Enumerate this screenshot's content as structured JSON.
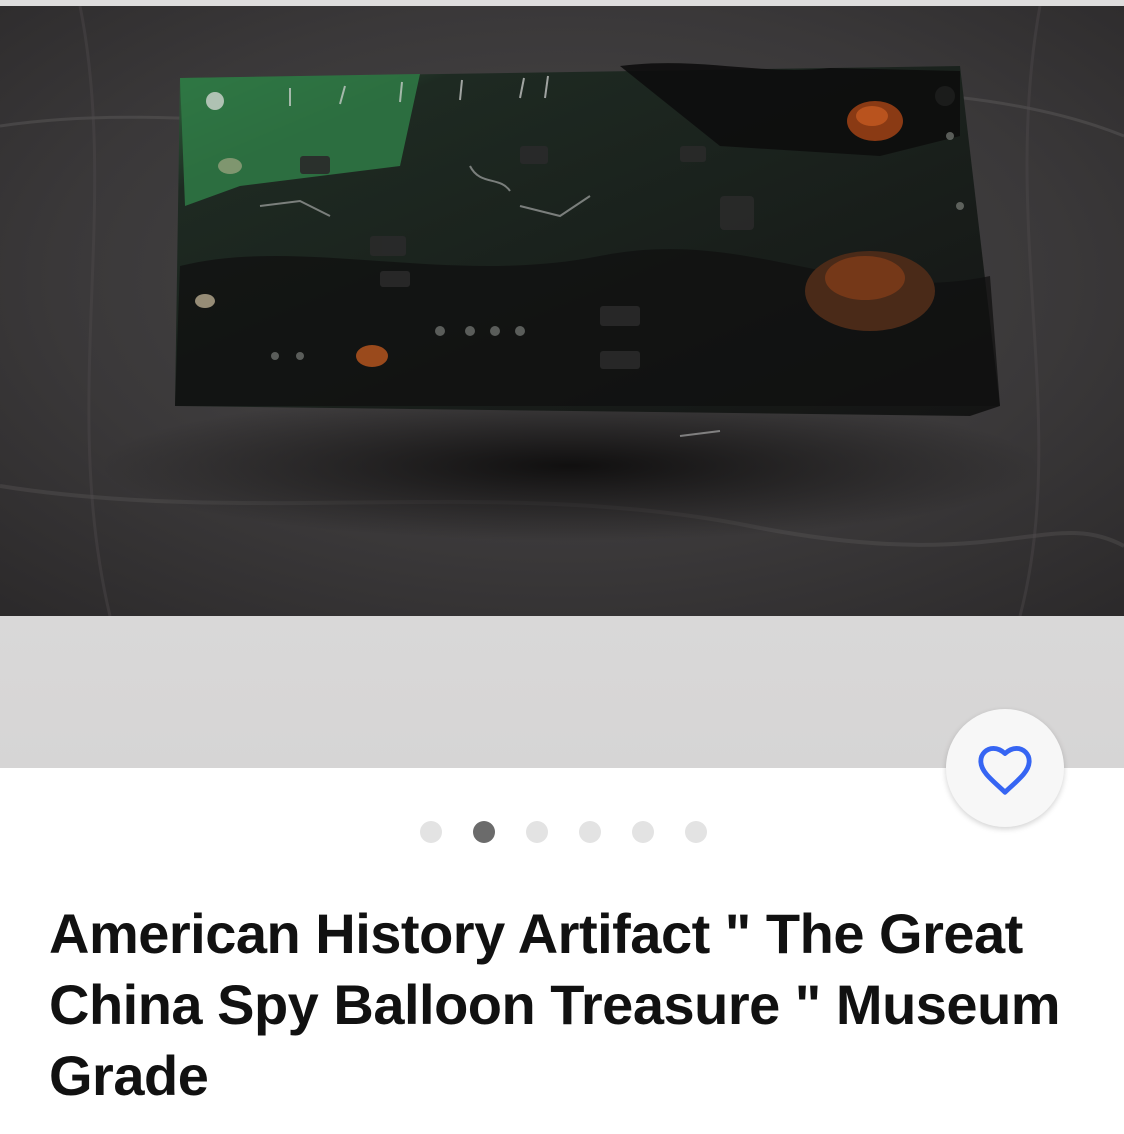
{
  "listing": {
    "title": "American History Artifact \" The Great China Spy Balloon Treasure \" Museum Grade",
    "image": {
      "description_icon": "burnt-circuit-board-photo"
    },
    "favorite_icon": "heart-outline-icon",
    "gallery_dots": {
      "count": 6,
      "active_index": 1
    }
  },
  "colors": {
    "accent_blue": "#3665f3",
    "title_text": "#111111",
    "dot_inactive": "#e3e3e3",
    "dot_active": "#6b6b6b"
  }
}
